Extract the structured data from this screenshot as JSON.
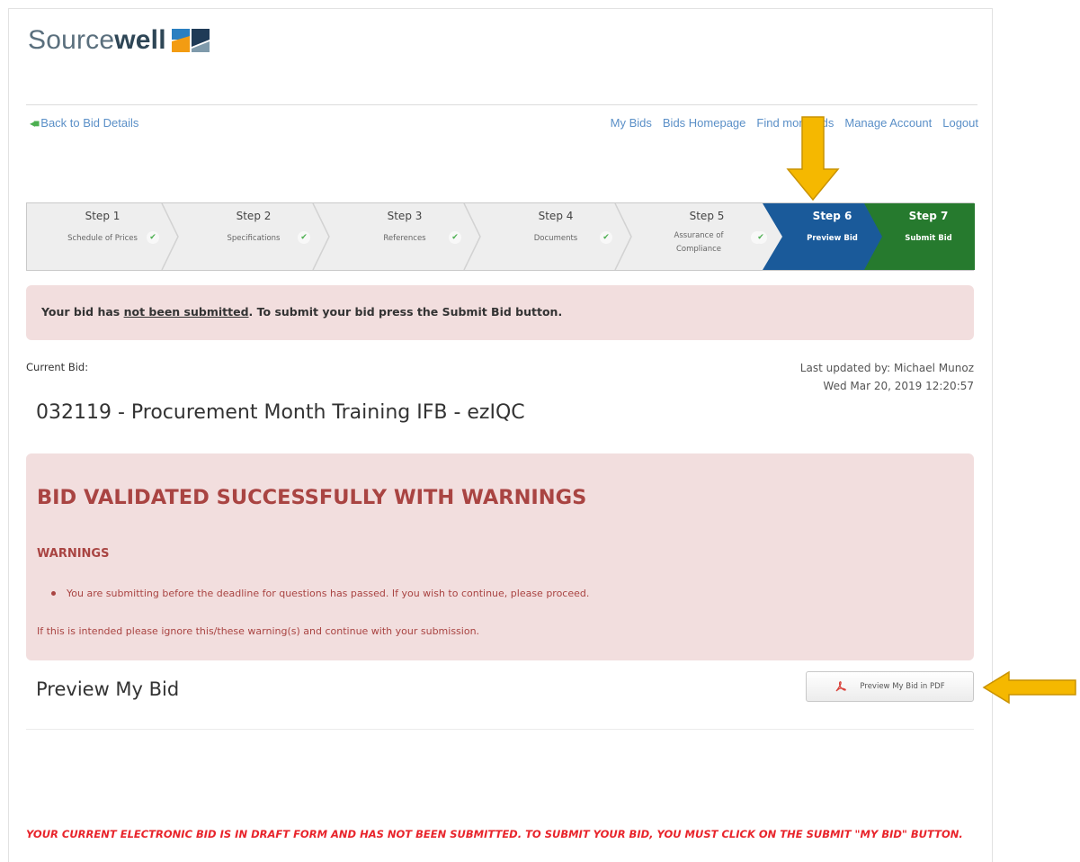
{
  "brand": {
    "name_light": "Source",
    "name_bold": "well"
  },
  "nav": {
    "back_label": "Back to Bid Details",
    "links": [
      "My Bids",
      "Bids Homepage",
      "Find more bids",
      "Manage Account",
      "Logout"
    ]
  },
  "steps": [
    {
      "title": "Step 1",
      "sub": "Schedule of Prices"
    },
    {
      "title": "Step 2",
      "sub": "Specifications"
    },
    {
      "title": "Step 3",
      "sub": "References"
    },
    {
      "title": "Step 4",
      "sub": "Documents"
    },
    {
      "title": "Step 5",
      "sub": "Assurance of Compliance"
    },
    {
      "title": "Step 6",
      "sub": "Preview Bid"
    },
    {
      "title": "Step 7",
      "sub": "Submit Bid"
    }
  ],
  "alert": {
    "prefix": "Your bid has ",
    "underlined": "not been submitted",
    "suffix": ". To submit your bid press the Submit Bid button."
  },
  "current": {
    "label": "Current Bid:",
    "updated_by": "Last updated by: Michael Munoz",
    "updated_at": "Wed Mar 20, 2019 12:20:57",
    "bid_title": "032119 - Procurement Month Training IFB - ezIQC"
  },
  "validation": {
    "heading": "BID VALIDATED SUCCESSFULLY WITH WARNINGS",
    "subheading": "WARNINGS",
    "items": [
      "You are submitting before the deadline for questions has passed.  If you wish to continue, please proceed."
    ],
    "note": "If this is intended please ignore this/these warning(s) and continue with your submission."
  },
  "preview": {
    "title": "Preview My Bid",
    "pdf_button": "Preview My Bid in PDF"
  },
  "draft_notice": "YOUR CURRENT ELECTRONIC BID IS IN DRAFT FORM AND HAS NOT BEEN SUBMITTED. TO SUBMIT YOUR BID, YOU MUST CLICK ON THE SUBMIT \"MY BID\" BUTTON.",
  "colors": {
    "active_step": "#1a5a9a",
    "submit_step": "#267a2e",
    "alert_bg": "#f2dede",
    "warning_text": "#a94442",
    "callout_arrow": "#f5b800"
  },
  "icons": {
    "check": "check-icon",
    "pdf": "pdf-icon",
    "back": "back-arrow-icon"
  }
}
